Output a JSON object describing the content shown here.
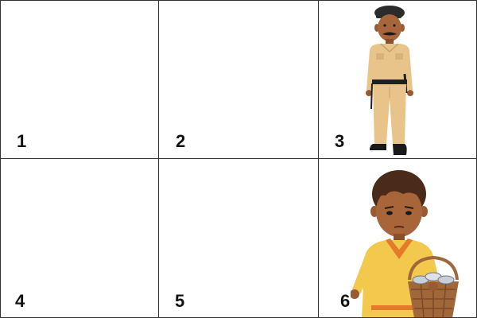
{
  "cells": [
    {
      "number": "1",
      "content": ""
    },
    {
      "number": "2",
      "content": ""
    },
    {
      "number": "3",
      "content": "police-officer-illustration"
    },
    {
      "number": "4",
      "content": ""
    },
    {
      "number": "5",
      "content": ""
    },
    {
      "number": "6",
      "content": "boy-with-fish-basket-illustration"
    }
  ],
  "colors": {
    "border": "#333333",
    "uniform": "#E8C48A",
    "skin": "#9A5A33",
    "beret": "#2B2B2B",
    "sweater": "#F2C94C",
    "basket": "#A0673A"
  }
}
